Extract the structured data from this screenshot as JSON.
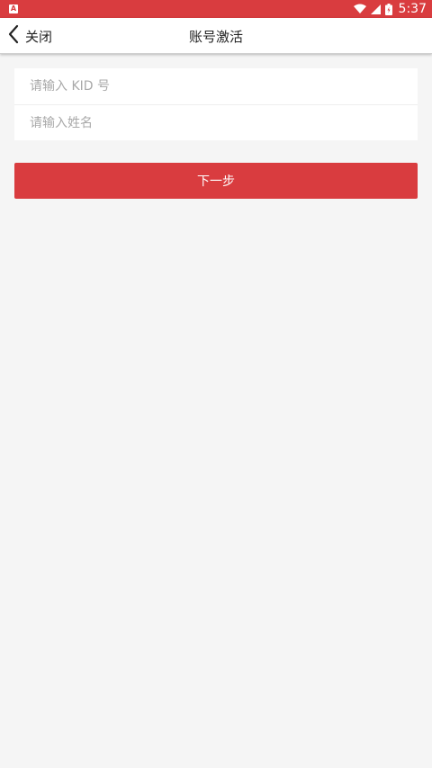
{
  "status_bar": {
    "time": "5:37",
    "app_badge_letter": "A",
    "icons": [
      "wifi-icon",
      "signal-icon",
      "battery-icon"
    ]
  },
  "navbar": {
    "back_label": "关闭",
    "title": "账号激活"
  },
  "form": {
    "kid_placeholder": "请输入 KID 号",
    "kid_value": "",
    "name_placeholder": "请输入姓名",
    "name_value": ""
  },
  "next_button": {
    "label": "下一步"
  },
  "colors": {
    "accent": "#d93c3f",
    "background": "#f5f5f5",
    "placeholder": "#a9a9a9"
  }
}
